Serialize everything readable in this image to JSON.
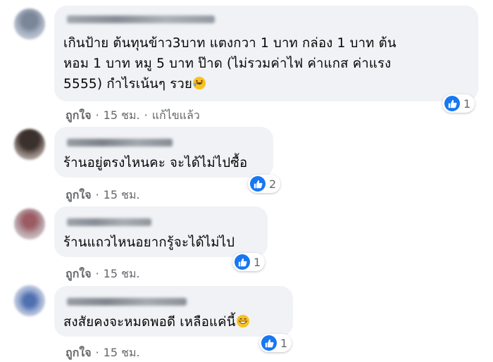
{
  "comments": [
    {
      "text": "เกินป้าย ต้นทุนข้าว3บาท แตงกวา 1 บาท กล่อง 1 บาท ต้น\nหอม 1 บาท หมู 5 บาท ป๊าด (ไม่รวมค่าไฟ ค่าแกส ค่าแรง\n5555) กำไรเน้นๆ รวย",
      "emoji": "rofl-emoji",
      "like_label": "ถูกใจ",
      "time": "15 ชม.",
      "edited": "แก้ไขแล้ว",
      "reaction_count": "1"
    },
    {
      "text": "ร้านอยู่ตรงไหนคะ จะได้ไม่ไปซื้อ",
      "like_label": "ถูกใจ",
      "time": "15 ชม.",
      "reaction_count": "2"
    },
    {
      "text": "ร้านแถวไหนอยากรู้จะได้ไม่ไป",
      "like_label": "ถูกใจ",
      "time": "15 ชม.",
      "reaction_count": "1"
    },
    {
      "text": "สงสัยคงจะหมดพอดี เหลือแค่นี้",
      "emoji": "grin-emoji",
      "like_label": "ถูกใจ",
      "time": "15 ชม.",
      "reaction_count": "1"
    }
  ],
  "colors": {
    "bubble": "#f0f2f5",
    "meta_text": "#65676b",
    "like_blue": "#1877f2"
  }
}
